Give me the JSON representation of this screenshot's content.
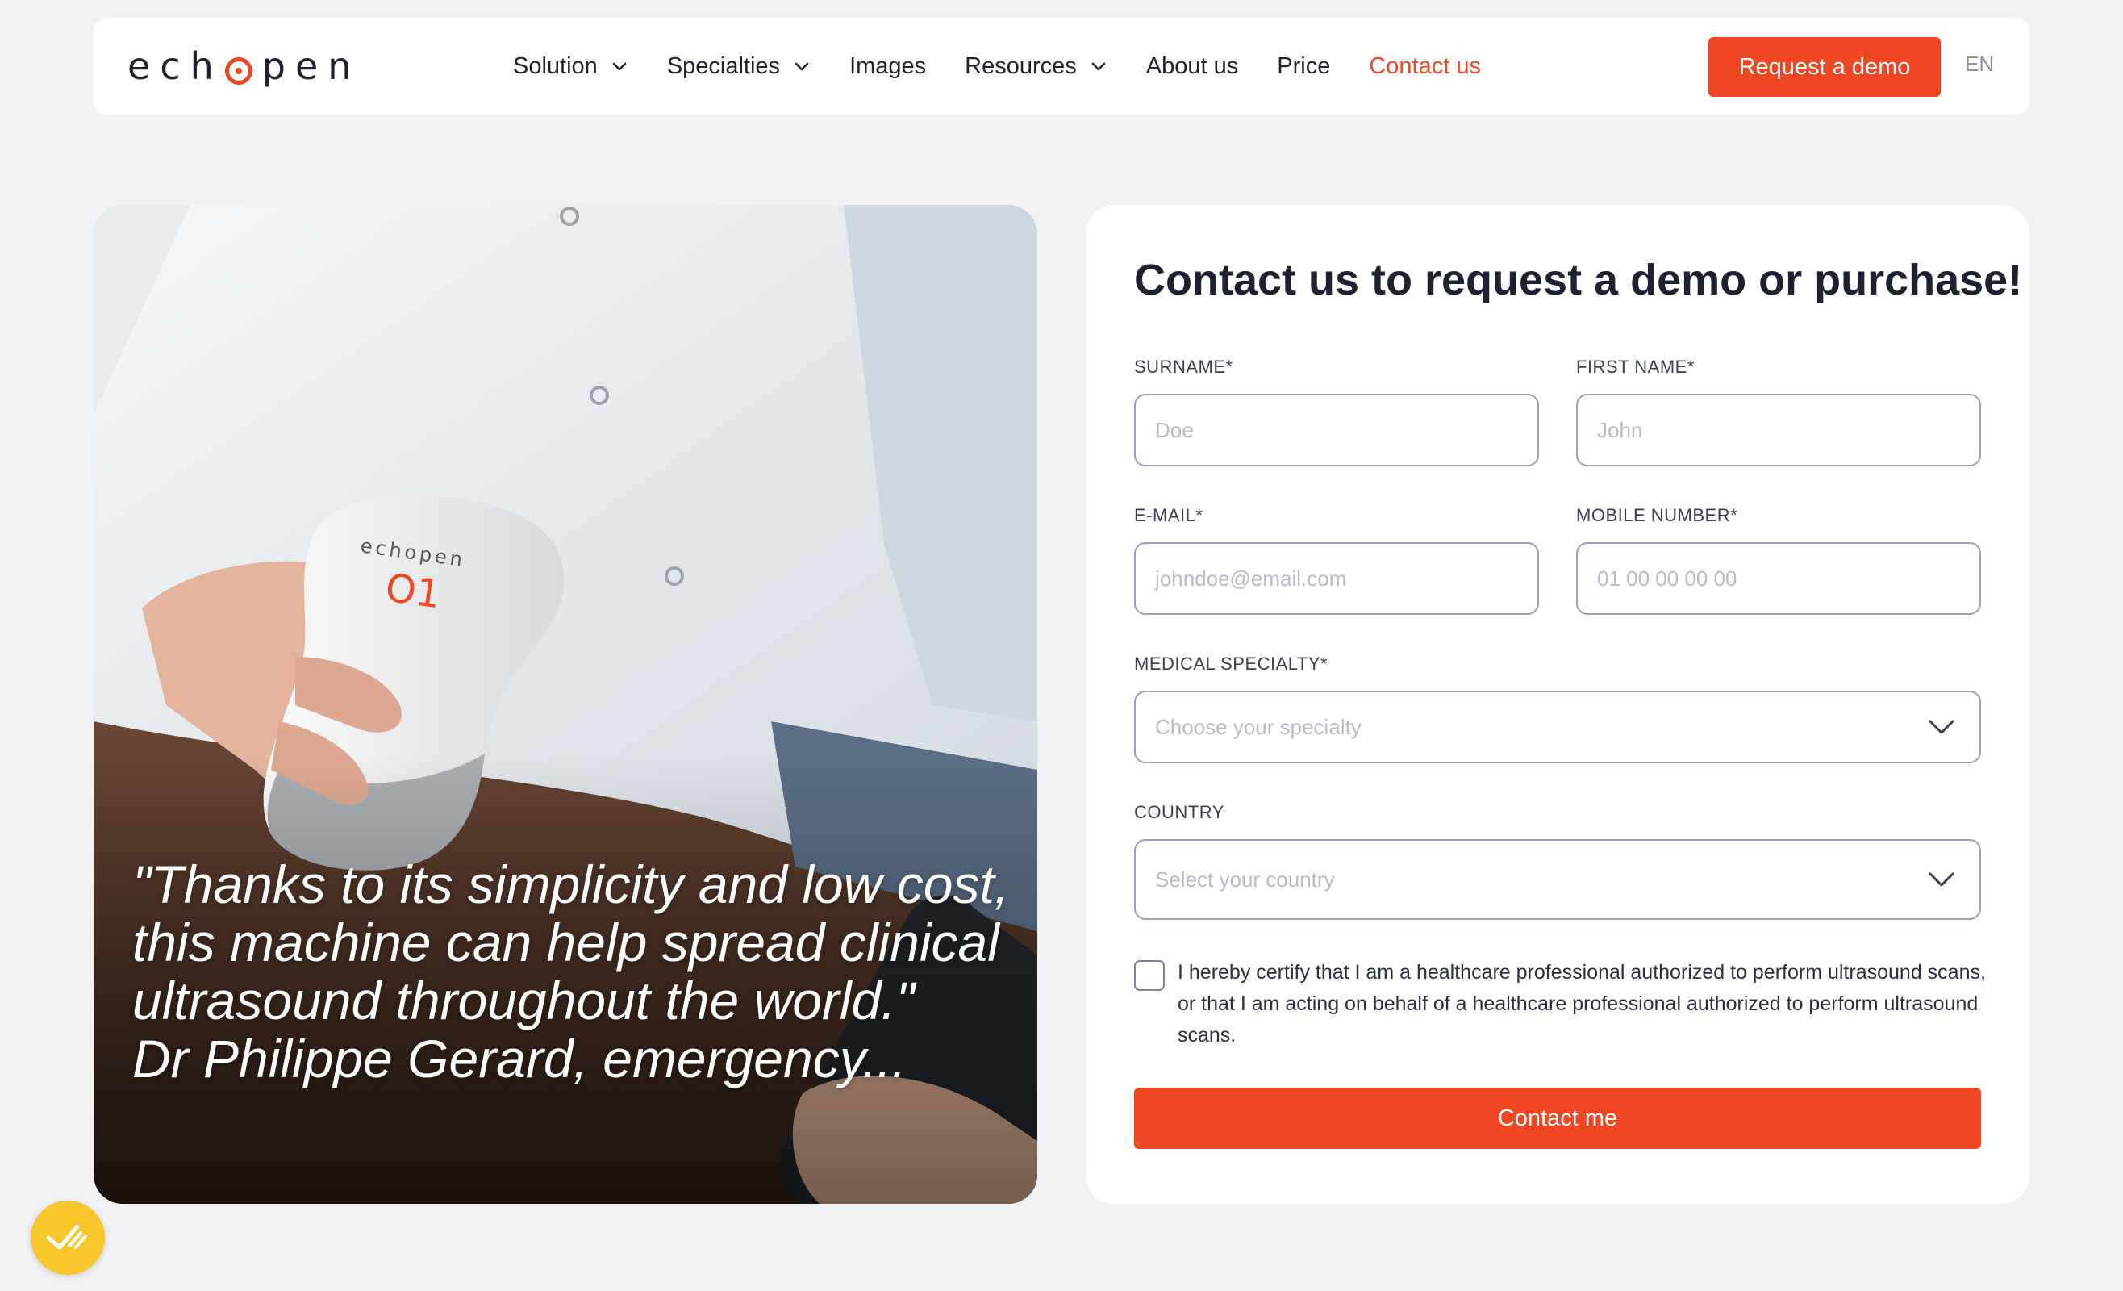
{
  "brand": {
    "logo_text_left": "ech",
    "logo_text_right": "pen",
    "accent_color": "#ef4723"
  },
  "nav": {
    "items": [
      {
        "label": "Solution",
        "dropdown": true
      },
      {
        "label": "Specialties",
        "dropdown": true
      },
      {
        "label": "Images",
        "dropdown": false
      },
      {
        "label": "Resources",
        "dropdown": true
      },
      {
        "label": "About us",
        "dropdown": false
      },
      {
        "label": "Price",
        "dropdown": false
      },
      {
        "label": "Contact us",
        "dropdown": false,
        "active": true
      }
    ],
    "cta_label": "Request a demo",
    "language": "EN"
  },
  "hero": {
    "device_brand": "echopen",
    "device_model": "O1",
    "quote": "\"Thanks to its simplicity and low cost, this machine can help spread clinical ultrasound throughout the world.\"",
    "author": "Dr Philippe Gerard, emergency..."
  },
  "form": {
    "title": "Contact us to request a demo or purchase!",
    "surname": {
      "label": "SURNAME*",
      "placeholder": "Doe"
    },
    "first_name": {
      "label": "FIRST NAME*",
      "placeholder": "John"
    },
    "email": {
      "label": "E-MAIL*",
      "placeholder": "johndoe@email.com"
    },
    "mobile": {
      "label": "MOBILE NUMBER*",
      "placeholder": "01 00 00 00 00"
    },
    "specialty": {
      "label": "MEDICAL SPECIALTY*",
      "placeholder": "Choose your specialty"
    },
    "country": {
      "label": "COUNTRY",
      "placeholder": "Select your country"
    },
    "consent_text": "I hereby certify that I am a healthcare professional authorized to perform ultrasound scans, or that I am acting on behalf of a healthcare professional authorized to perform ultrasound scans.",
    "consent_checked": false,
    "submit_label": "Contact me"
  },
  "floating_badge": {
    "icon": "checkmark-badge-icon",
    "color": "#f7c62a"
  }
}
